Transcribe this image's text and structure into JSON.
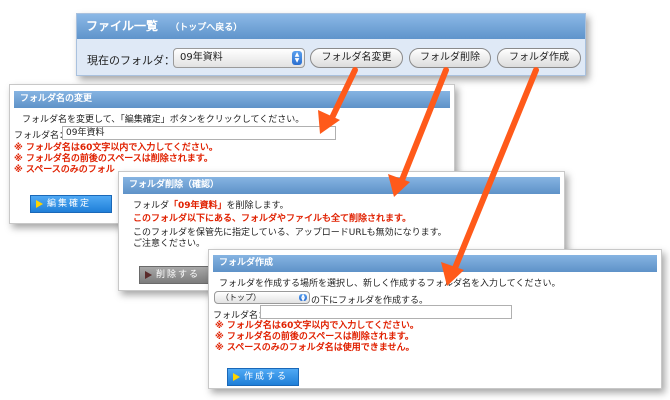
{
  "header": {
    "title": "ファイル一覧",
    "back_link": "（トップへ戻る）",
    "current_folder_label": "現在のフォルダ：",
    "current_folder_value": "09年資料",
    "rename_button": "フォルダ名変更",
    "delete_button": "フォルダ削除",
    "create_button": "フォルダ作成"
  },
  "rename_panel": {
    "title": "フォルダ名の変更",
    "instruction": "フォルダ名を変更して、「編集確定」ボタンをクリックしてください。",
    "field_label": "フォルダ名：",
    "field_value": "09年資料",
    "rules": [
      "※ フォルダ名は60文字以内で入力してください。",
      "※ フォルダ名の前後のスペースは削除されます。",
      "※ スペースのみのフォル"
    ],
    "confirm_button": "編集確定"
  },
  "delete_panel": {
    "title": "フォルダ削除（確認）",
    "line1_prefix": "フォルダ",
    "line1_target": "「09年資料」",
    "line1_suffix": "を削除します。",
    "warning": "このフォルダ以下にある、フォルダやファイルも全て削除されます。",
    "note1": "このフォルダを保管先に指定している、アップロードURLも無効になります。",
    "note2": "ご注意ください。",
    "delete_button": "削除する"
  },
  "create_panel": {
    "title": "フォルダ作成",
    "instruction": "フォルダを作成する場所を選択し、新しく作成するフォルダ名を入力してください。",
    "location_value": "（トップ）",
    "location_suffix": "の下にフォルダを作成する。",
    "field_label": "フォルダ名：",
    "field_value": "",
    "rules": [
      "※ フォルダ名は60文字以内で入力してください。",
      "※ フォルダ名の前後のスペースは削除されます。",
      "※ スペースのみのフォルダ名は使用できません。"
    ],
    "create_button": "作成する"
  },
  "colors": {
    "title_bar": "#6fa3d8",
    "arrow": "#ff5a1a",
    "rule_text": "#e02000",
    "button_blue": "#2a8ae4"
  }
}
